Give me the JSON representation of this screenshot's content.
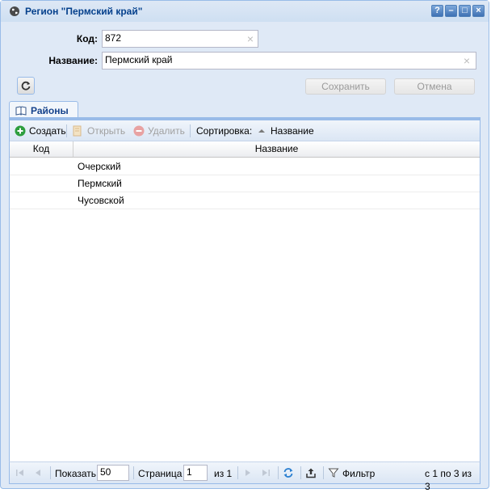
{
  "window": {
    "title": "Регион \"Пермский край\"",
    "buttons": [
      "?",
      "–",
      "□",
      "×"
    ]
  },
  "form": {
    "code_label": "Код:",
    "code_value": "872",
    "name_label": "Название:",
    "name_value": "Пермский край",
    "save_label": "Сохранить",
    "cancel_label": "Отмена"
  },
  "tab": {
    "label": "Районы"
  },
  "toolbar": {
    "create": "Создать",
    "open": "Открыть",
    "delete": "Удалить",
    "sort_label": "Сортировка:",
    "sort_field": "Название"
  },
  "grid": {
    "columns": [
      "Код",
      "Название"
    ],
    "rows": [
      {
        "code": "",
        "name": "Очерский"
      },
      {
        "code": "",
        "name": "Пермский"
      },
      {
        "code": "",
        "name": "Чусовской"
      }
    ]
  },
  "paging": {
    "show_label": "Показать",
    "page_size": "50",
    "page_label": "Страница",
    "page_value": "1",
    "of_label": "из 1",
    "filter_label": "Фильтр",
    "summary": "с 1 по 3 из 3"
  },
  "colors": {
    "accent": "#99bbe8",
    "title_text": "#04408c",
    "create_icon": "#2e9e3e",
    "delete_icon": "#e07b7b"
  }
}
